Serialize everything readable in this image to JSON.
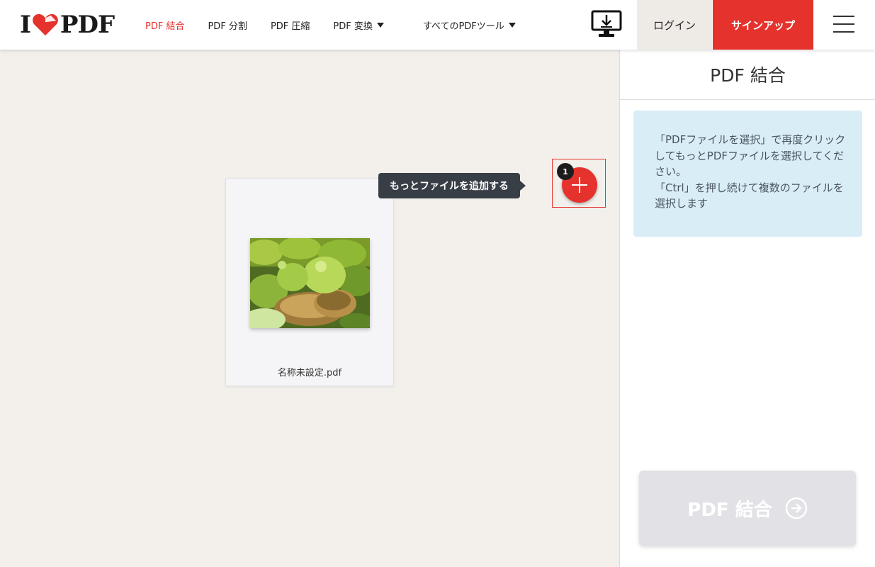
{
  "header": {
    "logo": {
      "left": "I",
      "right": "PDF"
    },
    "nav": [
      {
        "label": "PDF 結合",
        "active": true,
        "dropdown": false
      },
      {
        "label": "PDF 分割",
        "active": false,
        "dropdown": false
      },
      {
        "label": "PDF 圧縮",
        "active": false,
        "dropdown": false
      },
      {
        "label": "PDF 変換",
        "active": false,
        "dropdown": true
      },
      {
        "label": "すべてのPDFツール",
        "active": false,
        "dropdown": true
      }
    ],
    "login_label": "ログイン",
    "signup_label": "サインアップ"
  },
  "workspace": {
    "file": {
      "name": "名称未設定.pdf"
    },
    "tooltip": "もっとファイルを追加する",
    "file_count": "1"
  },
  "sidebar": {
    "title": "PDF 結合",
    "info_lines": [
      "「PDFファイルを選択」で再度クリックしてもっとPDFファイルを選択してください。",
      "「Ctrl」を押し続けて複数のファイルを選択します"
    ],
    "merge_button": "PDF 結合"
  },
  "colors": {
    "brand_red": "#e5322d",
    "info_bg": "#d9edf7",
    "workspace_bg": "#f3f0ec",
    "tooltip_bg": "#383e45"
  }
}
